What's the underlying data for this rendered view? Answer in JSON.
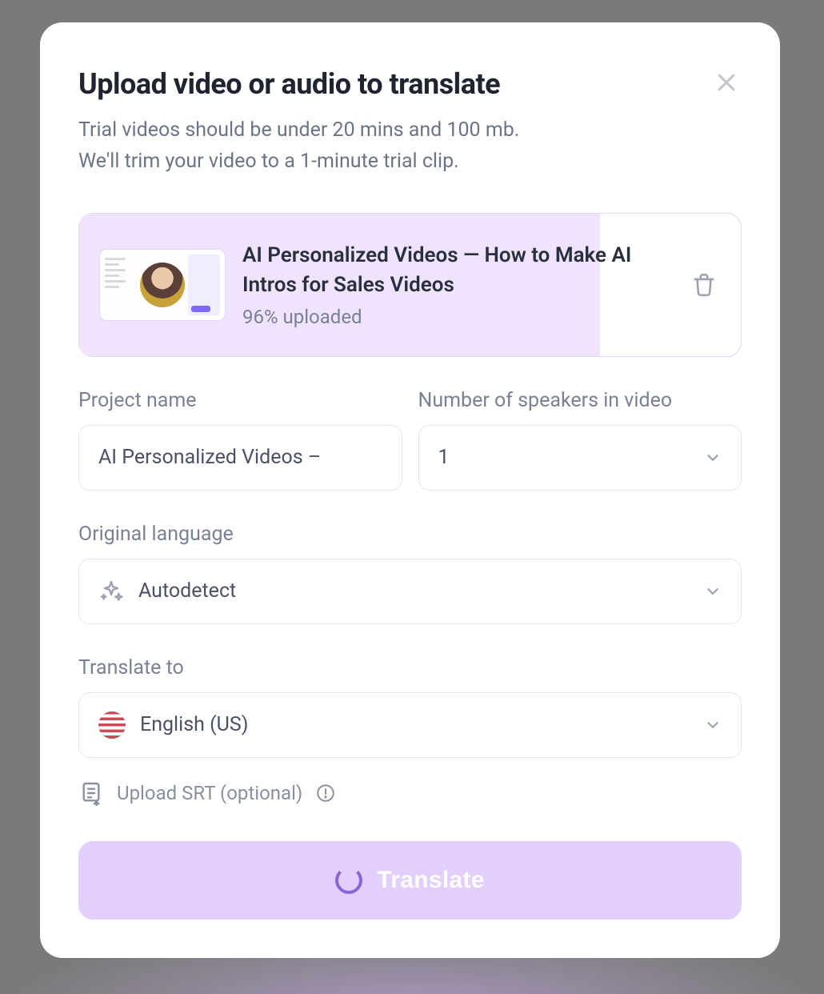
{
  "modal": {
    "title": "Upload video or audio to translate",
    "subtitle_line1": "Trial videos should be under 20 mins and 100 mb.",
    "subtitle_line2": "We'll trim your video to a 1-minute trial clip."
  },
  "upload": {
    "file_title": "AI Personalized Videos — How to Make AI Intros for Sales Videos",
    "progress_percent": 96,
    "status_text": "96% uploaded"
  },
  "form": {
    "project_name": {
      "label": "Project name",
      "value": "AI Personalized Videos –"
    },
    "speakers": {
      "label": "Number of speakers in video",
      "value": "1"
    },
    "original_lang": {
      "label": "Original language",
      "value": "Autodetect"
    },
    "translate_to": {
      "label": "Translate to",
      "value": "English (US)"
    }
  },
  "srt": {
    "label": "Upload SRT (optional)"
  },
  "cta": {
    "label": "Translate"
  },
  "colors": {
    "accent": "#e3cffb",
    "progress_fill": "#efe3ff"
  }
}
